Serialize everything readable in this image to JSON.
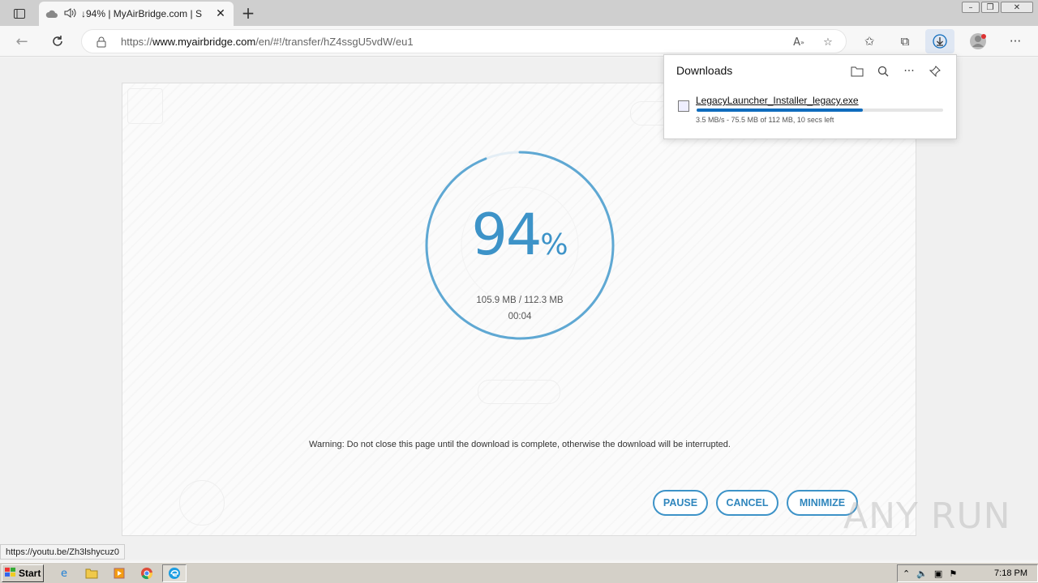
{
  "browser": {
    "tab_title": "↓94% | MyAirBridge.com | S",
    "url_prefix": "https://",
    "url_host": "www.myairbridge.com",
    "url_path": "/en/#!/transfer/hZ4ssgU5vdW/eu1"
  },
  "transfer": {
    "percent_number": "94",
    "percent_sign": "%",
    "progress_fraction": 0.94,
    "sizes": "105.9 MB / 112.3 MB",
    "time": "00:04",
    "warning": "Warning: Do not close this page until the download is complete, otherwise the download will be interrupted.",
    "pause_label": "PAUSE",
    "cancel_label": "CANCEL",
    "minimize_label": "MINIMIZE"
  },
  "downloads": {
    "title": "Downloads",
    "file_name": "LegacyLauncher_Installer_legacy.exe",
    "progress_fraction": 0.674,
    "status": "3.5 MB/s - 75.5 MB of 112 MB, 10 secs left"
  },
  "status_url": "https://youtu.be/Zh3lshycuz0",
  "watermark": "ANY RUN",
  "taskbar": {
    "start_label": "Start",
    "clock": "7:18 PM"
  },
  "colors": {
    "accent": "#3d93c8",
    "download_blue": "#0f6cbd"
  }
}
